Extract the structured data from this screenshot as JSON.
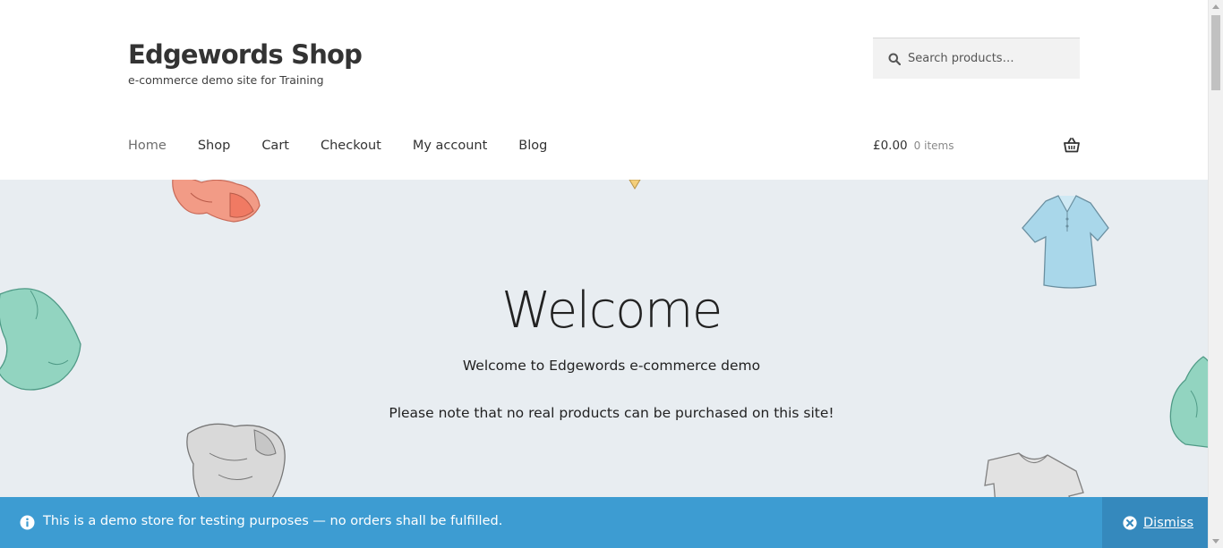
{
  "header": {
    "site_title": "Edgewords Shop",
    "site_description": "e-commerce demo site for Training",
    "search": {
      "placeholder": "Search products…",
      "value": ""
    },
    "nav": [
      {
        "label": "Home",
        "current": true
      },
      {
        "label": "Shop"
      },
      {
        "label": "Cart"
      },
      {
        "label": "Checkout"
      },
      {
        "label": "My account"
      },
      {
        "label": "Blog"
      }
    ],
    "cart": {
      "amount": "£0.00",
      "count": "0 items"
    }
  },
  "hero": {
    "title": "Welcome",
    "line1": "Welcome to Edgewords e-commerce demo",
    "line2": "Please note that no real products can be purchased on this site!"
  },
  "store_notice": {
    "text": "This is a demo store for testing purposes — no orders shall be fulfilled.",
    "dismiss_label": "Dismiss"
  },
  "icons": {
    "search": "search-icon",
    "cart": "shopping-basket-icon",
    "notice": "info-icon",
    "dismiss": "close-circle-icon"
  },
  "colors": {
    "notice_background": "#3d9cd2",
    "dismiss_background": "#3589bd",
    "hero_background": "#e8edf1",
    "text": "#333333"
  }
}
